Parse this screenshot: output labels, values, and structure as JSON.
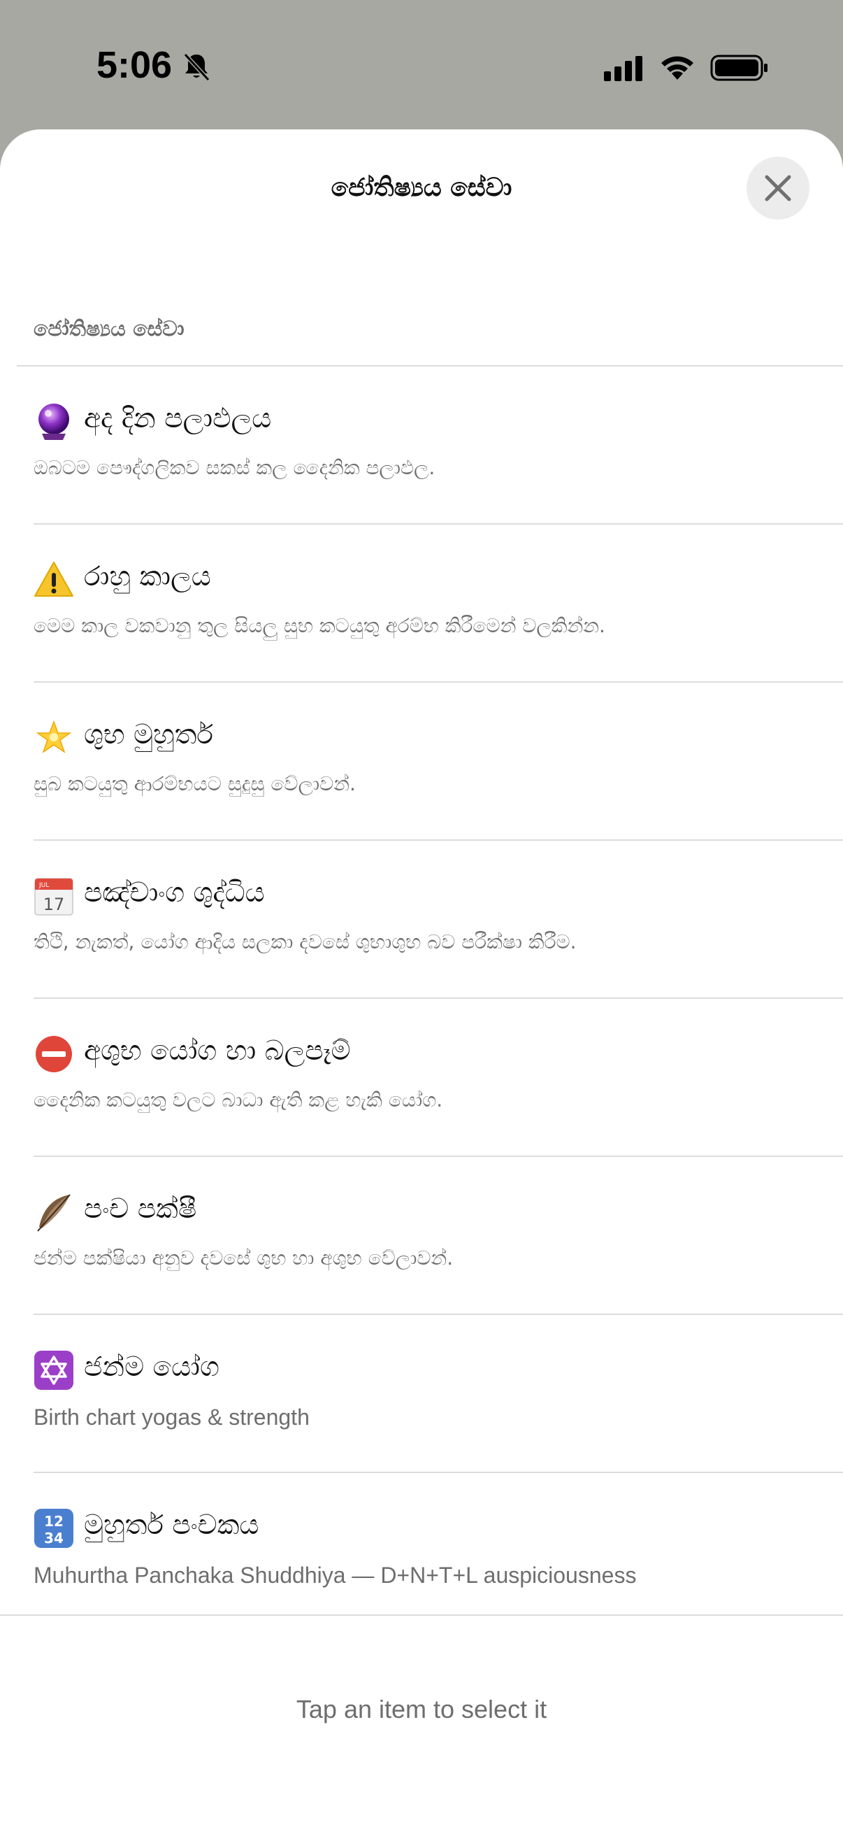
{
  "status_bar": {
    "time": "5:06",
    "icons": [
      "bell-slash-icon",
      "cellular-signal-icon",
      "wifi-icon",
      "battery-icon"
    ]
  },
  "sheet": {
    "title": "ජෝතිෂ්‍යය සේවා",
    "close_icon": "close-icon",
    "section_header": "ජෝතිෂ්‍යය සේවා"
  },
  "items": [
    {
      "icon": "crystal-ball-icon",
      "title": "අද දින පලාඵලය",
      "subtitle": "ඔබටම පෞද්ගලිකව සකස් කල දෛනික පලාඵල."
    },
    {
      "icon": "warning-icon",
      "title": "රාහු කාලය",
      "subtitle": "මෙම කාල වකවානු තුල සියලු සුභ කටයුතු අරම්භ කිරීමෙන් වලකින්න."
    },
    {
      "icon": "glowing-star-icon",
      "title": "ශුභ මුහුර්ත",
      "subtitle": "සුබ කටයුතු ආරම්භයට සුදුසු වේලාවන්."
    },
    {
      "icon": "calendar-icon",
      "title": "පඤ්චාංග ශුද්ධිය",
      "subtitle": "තිථි, නැකත්, යෝග ආදිය සලකා දවසේ ශුභාශුභ බව පරීක්ෂා කිරීම."
    },
    {
      "icon": "no-entry-icon",
      "title": "අශුභ යෝග හා බලපෑම්",
      "subtitle": "දෛනික කටයුතු වලට බාධා ඇති කළ හැකි යෝග."
    },
    {
      "icon": "feather-icon",
      "title": "පංච පක්ෂී",
      "subtitle": "ජන්ම පක්ෂියා අනුව දවසේ ශුභ හා අශුභ වේලාවන්."
    },
    {
      "icon": "star-of-david-icon",
      "title": "ජන්ම යෝග",
      "subtitle": "Birth chart yogas & strength"
    },
    {
      "icon": "number-keys-icon",
      "icon_text": "1234",
      "title": "මුහුර්ත පංචකය",
      "subtitle": "Muhurtha Panchaka Shuddhiya — D+N+T+L auspiciousness"
    }
  ],
  "calendar_icon": {
    "month": "JUL",
    "day": "17"
  },
  "footer": {
    "hint": "Tap an item to select it"
  }
}
